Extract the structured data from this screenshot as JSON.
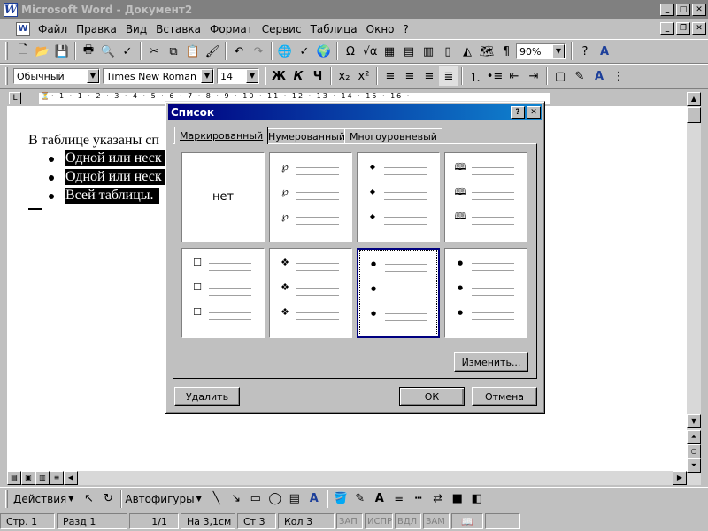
{
  "window": {
    "title": "Microsoft Word - Документ2"
  },
  "menu": {
    "items": [
      "Файл",
      "Правка",
      "Вид",
      "Вставка",
      "Формат",
      "Сервис",
      "Таблица",
      "Окно",
      "?"
    ]
  },
  "standard_toolbar": {
    "zoom": "90%"
  },
  "formatting_toolbar": {
    "style": "Обычный",
    "font": "Times New Roman",
    "size": "14",
    "bold": "Ж",
    "italic": "К",
    "underline": "Ч"
  },
  "document": {
    "intro": "В таблице указаны сп",
    "bullets": [
      "Одной или неск",
      "Одной или неск",
      "Всей таблицы."
    ]
  },
  "dialog": {
    "title": "Список",
    "help_btn": "?",
    "close_btn": "✕",
    "tabs": [
      "Маркированный",
      "Нумерованный",
      "Многоуровневый"
    ],
    "none_label": "нет",
    "styles": [
      {
        "name": "none",
        "symbol": ""
      },
      {
        "name": "swirl",
        "symbol": "℘"
      },
      {
        "name": "diamond",
        "symbol": "◆"
      },
      {
        "name": "book",
        "symbol": "🕮"
      },
      {
        "name": "square",
        "symbol": "☐"
      },
      {
        "name": "four-diamond",
        "symbol": "❖"
      },
      {
        "name": "dot-selected",
        "symbol": "●"
      },
      {
        "name": "dot",
        "symbol": "●"
      }
    ],
    "selected_index": 6,
    "modify_btn": "Изменить...",
    "delete_btn": "Удалить",
    "ok_btn": "ОК",
    "cancel_btn": "Отмена"
  },
  "drawing_toolbar": {
    "actions": "Действия",
    "autoshapes": "Автофигуры"
  },
  "statusbar": {
    "page": "Стр. 1",
    "section": "Разд 1",
    "pages": "1/1",
    "at": "На 3,1см",
    "line": "Ст 3",
    "col": "Кол 3",
    "rec": "ЗАП",
    "trk": "ИСПР",
    "ext": "ВДЛ",
    "ovr": "ЗАМ"
  }
}
